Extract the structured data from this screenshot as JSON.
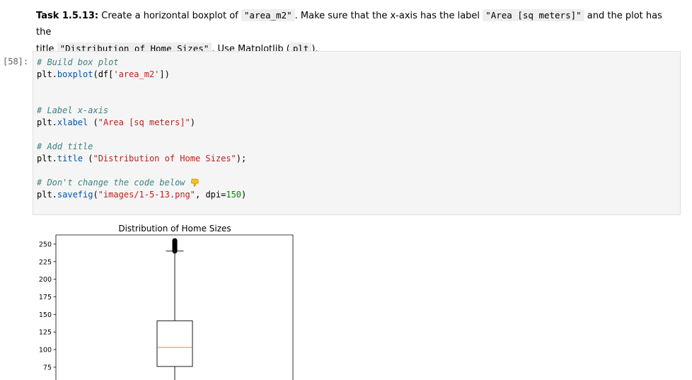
{
  "task": {
    "label": "Task 1.5.13:",
    "t1": " Create a horizontal boxplot of ",
    "c1": "\"area_m2\"",
    "t2": ". Make sure that the x-axis has the label ",
    "c2": "\"Area [sq meters]\"",
    "t3": " and the plot has the",
    "t4": "title ",
    "c3": "\"Distribution of Home Sizes\"",
    "t5": ". Use Matplotlib (",
    "c4": "plt",
    "t6": ")."
  },
  "cell": {
    "prompt": "[58]:",
    "lines": {
      "l1": "# Build box plot",
      "l2a": "plt.",
      "l2b": "boxplot",
      "l2c": "(df[",
      "l2d": "'area_m2'",
      "l2e": "])",
      "l3": "# Label x-axis",
      "l4a": "plt.",
      "l4b": "xlabel",
      "l4c": " (",
      "l4d": "\"Area [sq meters]\"",
      "l4e": ")",
      "l5": "# Add title",
      "l6a": "plt.",
      "l6b": "title",
      "l6c": " (",
      "l6d": "\"Distribution of Home Sizes\"",
      "l6e": ");",
      "l7": "# Don't change the code below ",
      "l8a": "plt.",
      "l8b": "savefig",
      "l8c": "(",
      "l8d": "\"images/1-5-13.png\"",
      "l8e": ", dpi=",
      "l8f": "150",
      "l8g": ")"
    }
  },
  "chart_data": {
    "type": "box",
    "title": "Distribution of Home Sizes",
    "yticks": [
      75,
      100,
      125,
      150,
      175,
      200,
      225,
      250
    ],
    "ylim": [
      63,
      263
    ],
    "box": {
      "q1": 76,
      "median": 103,
      "q3": 141,
      "whisker_low": 55,
      "whisker_high": 240,
      "outliers_from": 240,
      "outliers_to": 255
    },
    "colors": {
      "median": "#ff7f0e",
      "box": "#000000"
    }
  }
}
